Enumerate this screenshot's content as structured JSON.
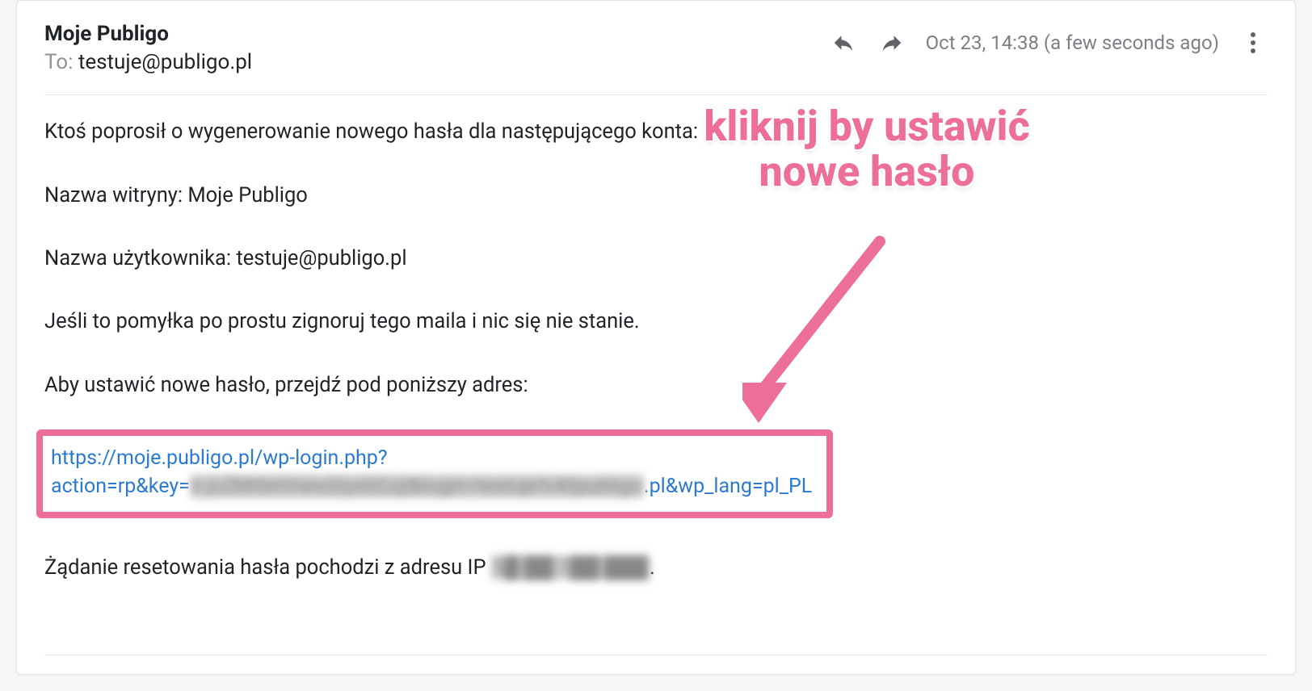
{
  "header": {
    "from_name": "Moje Publigo",
    "to_label": "To:",
    "to_address": "testuje@publigo.pl",
    "timestamp": "Oct 23, 14:38 (a few seconds ago)",
    "icons": {
      "reply": "reply-icon",
      "forward": "forward-icon",
      "more": "more-icon"
    }
  },
  "body": {
    "p1": "Ktoś poprosił o wygenerowanie nowego hasła dla następującego konta:",
    "p2": "Nazwa witryny: Moje Publigo",
    "p3": "Nazwa użytkownika: testuje@publigo.pl",
    "p4": "Jeśli to pomyłka po prostu zignoruj tego maila i nic się nie stanie.",
    "p5": "Aby ustawić nowe hasło, przejdź pod poniższy adres:",
    "link_line1": "https://moje.publigo.pl/wp-login.php?",
    "link_prefix2": "action=rp&key=",
    "link_key_obscured": "n jcZMrbHVsncDyxGCzjl&login=testuje%40publigo",
    "link_suffix2": ".pl&wp_lang=pl_PL",
    "p6_prefix": "Żądanie resetowania hasła pochodzi z adresu IP ",
    "p6_ip_obscured": "5█ ██ 1██ ███",
    "p6_suffix": "."
  },
  "annotation": {
    "text_line1": "kliknij by ustawić",
    "text_line2": "nowe hasło"
  },
  "colors": {
    "accent_pink": "#ed6e96",
    "link_blue": "#2a7ad2",
    "muted_gray": "#8e9399"
  }
}
